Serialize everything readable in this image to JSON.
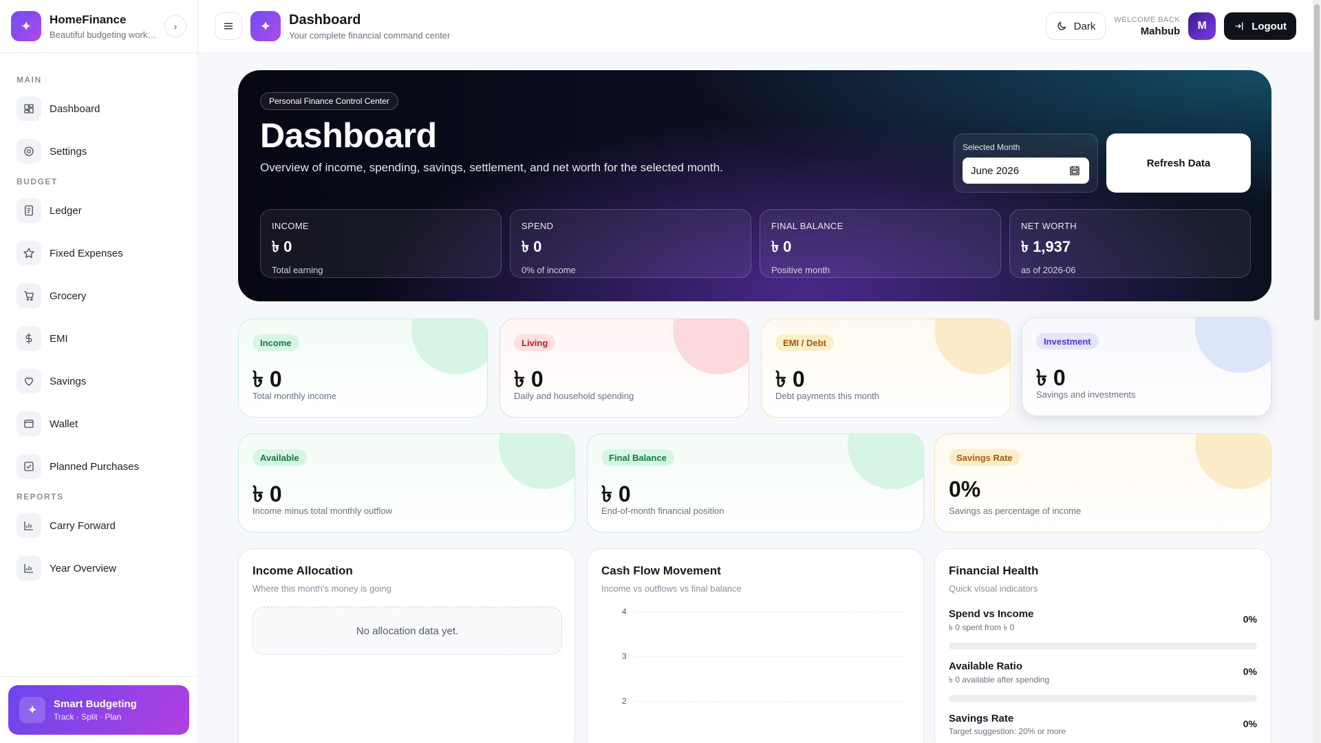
{
  "brand": {
    "title": "HomeFinance",
    "subtitle": "Beautiful budgeting workspace"
  },
  "nav": {
    "sections": {
      "main": "MAIN",
      "budget": "BUDGET",
      "reports": "REPORTS"
    },
    "items": [
      {
        "label": "Dashboard",
        "icon": "dashboard-icon"
      },
      {
        "label": "Settings",
        "icon": "gear-icon"
      },
      {
        "label": "Ledger",
        "icon": "ledger-icon"
      },
      {
        "label": "Fixed Expenses",
        "icon": "star-icon"
      },
      {
        "label": "Grocery",
        "icon": "cart-icon"
      },
      {
        "label": "EMI",
        "icon": "dollar-icon"
      },
      {
        "label": "Savings",
        "icon": "heart-icon"
      },
      {
        "label": "Wallet",
        "icon": "wallet-icon"
      },
      {
        "label": "Planned Purchases",
        "icon": "checkbox-icon"
      },
      {
        "label": "Carry Forward",
        "icon": "bar-chart-icon"
      },
      {
        "label": "Year Overview",
        "icon": "bar-chart-icon"
      }
    ]
  },
  "smart": {
    "title": "Smart Budgeting",
    "subtitle": "Track · Split · Plan"
  },
  "header": {
    "title": "Dashboard",
    "subtitle": "Your complete financial command center",
    "dark_label": "Dark",
    "welcome_small": "WELCOME BACK",
    "user_name": "Mahbub",
    "avatar_initial": "M",
    "logout_label": "Logout"
  },
  "hero": {
    "tag": "Personal Finance Control Center",
    "title": "Dashboard",
    "description": "Overview of income, spending, savings, settlement, and net worth for the selected month.",
    "month_label": "Selected Month",
    "month_value": "June 2026",
    "refresh_label": "Refresh Data",
    "stats": [
      {
        "label": "INCOME",
        "value": "৳ 0",
        "sub": "Total earning"
      },
      {
        "label": "SPEND",
        "value": "৳ 0",
        "sub": "0% of income"
      },
      {
        "label": "FINAL BALANCE",
        "value": "৳ 0",
        "sub": "Positive month"
      },
      {
        "label": "NET WORTH",
        "value": "৳ 1,937",
        "sub": "as of 2026-06"
      }
    ]
  },
  "cards_row1": [
    {
      "pill": "Income",
      "value": "৳ 0",
      "sub": "Total monthly income"
    },
    {
      "pill": "Living",
      "value": "৳ 0",
      "sub": "Daily and household spending"
    },
    {
      "pill": "EMI / Debt",
      "value": "৳ 0",
      "sub": "Debt payments this month"
    },
    {
      "pill": "Investment",
      "value": "৳ 0",
      "sub": "Savings and investments"
    }
  ],
  "cards_row2": [
    {
      "pill": "Available",
      "value": "৳ 0",
      "sub": "Income minus total monthly outflow"
    },
    {
      "pill": "Final Balance",
      "value": "৳ 0",
      "sub": "End-of-month financial position"
    },
    {
      "pill": "Savings Rate",
      "value": "0%",
      "sub": "Savings as percentage of income"
    }
  ],
  "allocation": {
    "title": "Income Allocation",
    "subtitle": "Where this month's money is going",
    "empty": "No allocation data yet."
  },
  "cashflow": {
    "title": "Cash Flow Movement",
    "subtitle": "Income vs outflows vs final balance",
    "ticks": [
      "4",
      "3",
      "2"
    ]
  },
  "health": {
    "title": "Financial Health",
    "subtitle": "Quick visual indicators",
    "rows": [
      {
        "title": "Spend vs Income",
        "sub": "৳ 0 spent from ৳ 0",
        "pct": "0%"
      },
      {
        "title": "Available Ratio",
        "sub": "৳ 0 available after spending",
        "pct": "0%"
      },
      {
        "title": "Savings Rate",
        "sub": "Target suggestion: 20% or more",
        "pct": "0%"
      }
    ]
  },
  "colors": {
    "accent": "#7c3aed",
    "income": "#1f9d5c",
    "living": "#c2410c",
    "emi": "#b45309",
    "investment": "#4f46e5"
  }
}
